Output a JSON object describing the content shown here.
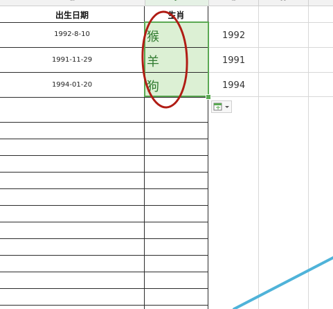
{
  "sheet": {
    "column_headers": [
      {
        "id": "E",
        "label": "E"
      },
      {
        "id": "F",
        "label": "F"
      },
      {
        "id": "G",
        "label": "G"
      },
      {
        "id": "H",
        "label": "H"
      }
    ],
    "table_headers": {
      "birth_date": "出生日期",
      "zodiac": "生肖"
    },
    "rows": [
      {
        "birth_date": "1992-8-10",
        "zodiac": "猴",
        "year": "1992"
      },
      {
        "birth_date": "1991-11-29",
        "zodiac": "羊",
        "year": "1991"
      },
      {
        "birth_date": "1994-01-20",
        "zodiac": "狗",
        "year": "1994"
      }
    ]
  },
  "ui": {
    "selection_color": "#dcf0d4",
    "selection_border": "#5aa852",
    "annotation_circle_color": "#b01c14",
    "paste_options_icon": "paste-options-icon"
  }
}
